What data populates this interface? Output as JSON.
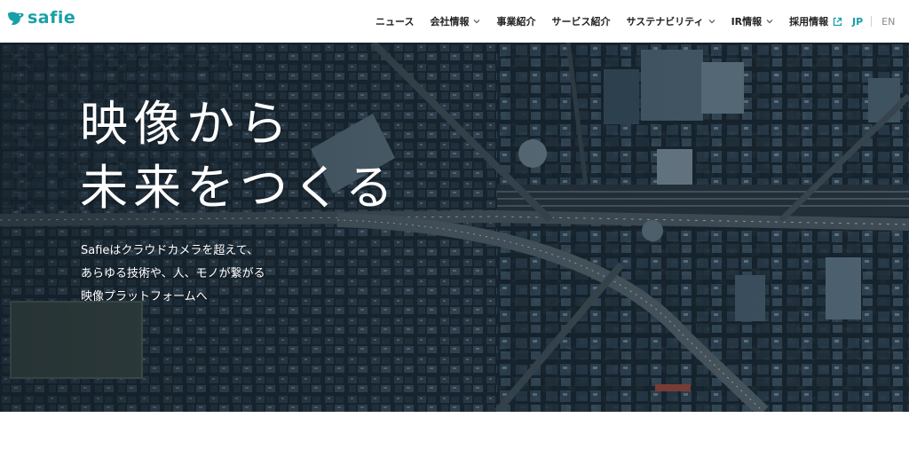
{
  "header": {
    "logo_text": "safie",
    "nav": [
      {
        "label": "ニュース",
        "dropdown": false,
        "external": false
      },
      {
        "label": "会社情報",
        "dropdown": true,
        "external": false
      },
      {
        "label": "事業紹介",
        "dropdown": false,
        "external": false
      },
      {
        "label": "サービス紹介",
        "dropdown": false,
        "external": false
      },
      {
        "label": "サステナビリティ",
        "dropdown": true,
        "external": false
      },
      {
        "label": "IR情報",
        "dropdown": true,
        "external": false
      },
      {
        "label": "採用情報",
        "dropdown": false,
        "external": true
      }
    ],
    "lang": {
      "jp": "JP",
      "en": "EN",
      "active": "JP"
    }
  },
  "hero": {
    "title_lines": [
      "映像から",
      "未来をつくる"
    ],
    "subtitle_lines": [
      "Safieはクラウドカメラを超えて、",
      "あらゆる技術や、人、モノが繋がる",
      "映像プラットフォームへ"
    ]
  },
  "colors": {
    "brand": "#18a0a8",
    "text": "#222222",
    "hero_overlay": "#1b2a36"
  },
  "icons": {
    "logo": "safie-bird-icon",
    "dropdown": "chevron-down-icon",
    "external": "external-link-icon"
  }
}
